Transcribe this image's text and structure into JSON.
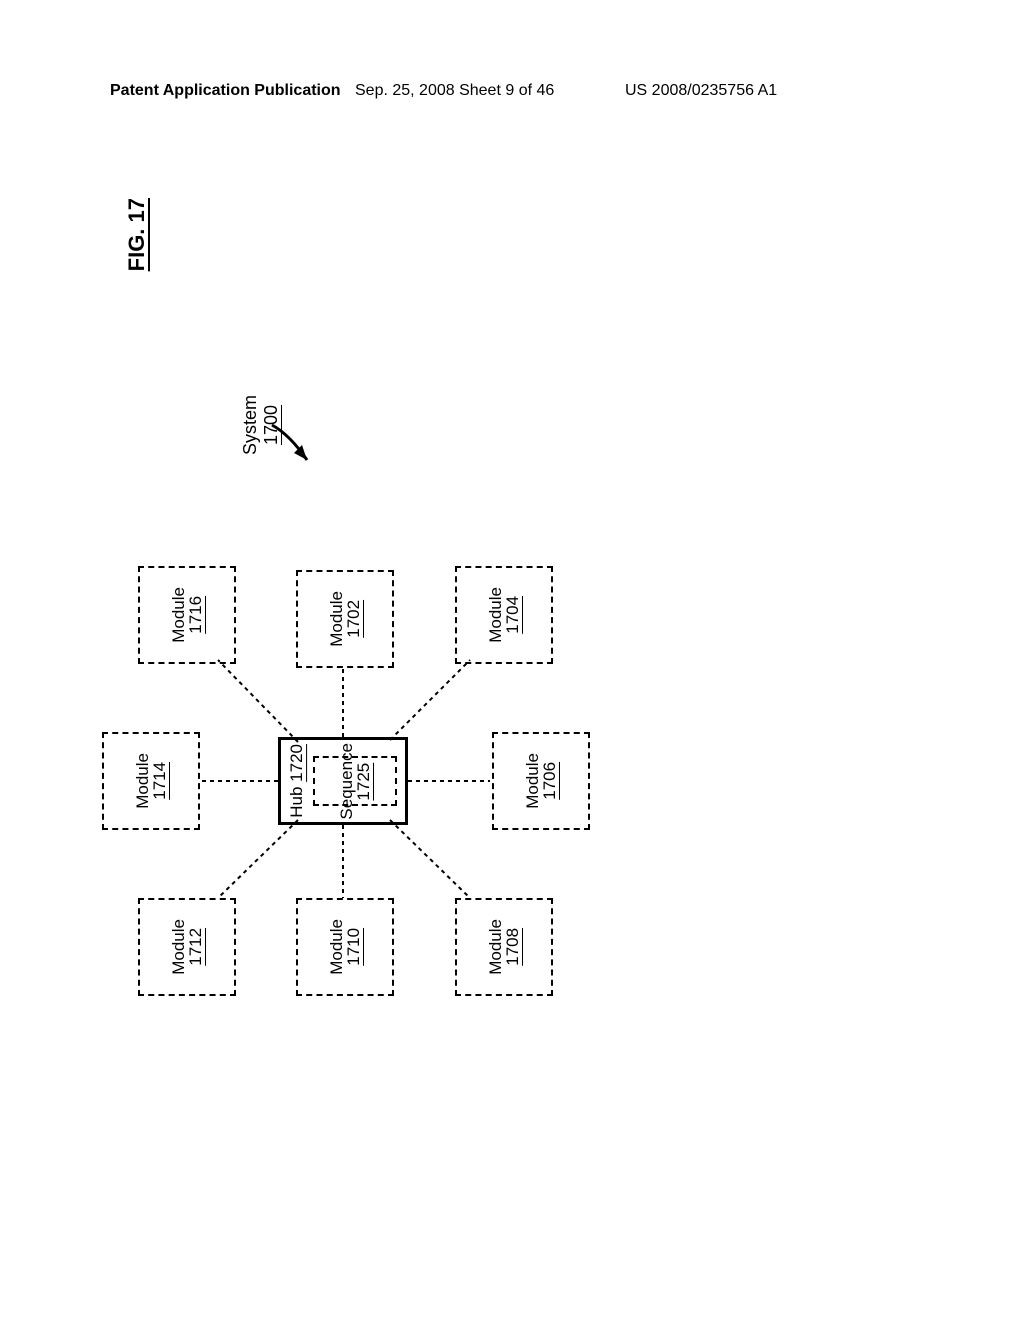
{
  "header": {
    "left": "Patent Application Publication",
    "center": "Sep. 25, 2008  Sheet 9 of 46",
    "right": "US 2008/0235756 A1"
  },
  "figure_label": "FIG. 17",
  "system_label": "System\n1700",
  "hub": {
    "title": "Hub",
    "num": "1720",
    "sequence": {
      "title": "Sequence",
      "num": "1725"
    }
  },
  "modules": {
    "m1702": {
      "title": "Module",
      "num": "1702"
    },
    "m1704": {
      "title": "Module",
      "num": "1704"
    },
    "m1706": {
      "title": "Module",
      "num": "1706"
    },
    "m1708": {
      "title": "Module",
      "num": "1708"
    },
    "m1710": {
      "title": "Module",
      "num": "1710"
    },
    "m1712": {
      "title": "Module",
      "num": "1712"
    },
    "m1714": {
      "title": "Module",
      "num": "1714"
    },
    "m1716": {
      "title": "Module",
      "num": "1716"
    }
  }
}
